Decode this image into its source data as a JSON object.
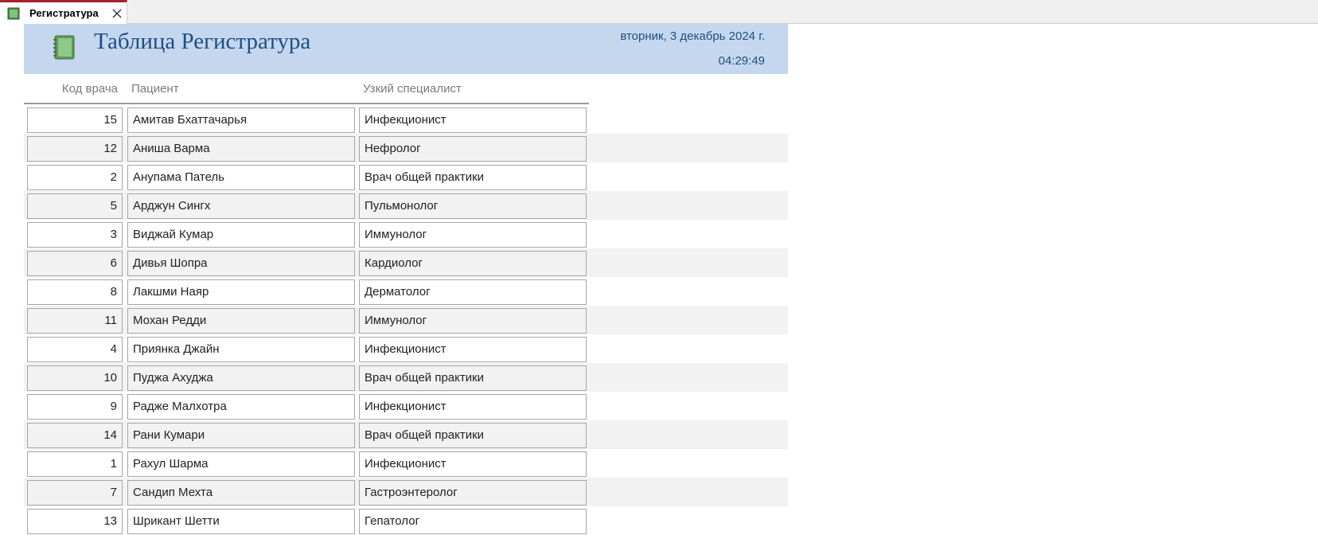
{
  "tab": {
    "label": "Регистратура",
    "icon": "report-icon",
    "close_icon": "close-icon"
  },
  "header": {
    "title": "Таблица Регистратура",
    "date": "вторник, 3 декабрь 2024 г.",
    "time": "04:29:49",
    "background": "#c5d7ef",
    "title_color": "#1f4e84"
  },
  "columns": {
    "code": "Код врача",
    "patient": "Пациент",
    "specialist": "Узкий специалист"
  },
  "rows": [
    {
      "code": "15",
      "patient": "Амитав Бхаттачарья",
      "specialist": "Инфекционист"
    },
    {
      "code": "12",
      "patient": "Аниша Варма",
      "specialist": "Нефролог"
    },
    {
      "code": "2",
      "patient": "Анупама Патель",
      "specialist": "Врач общей практики"
    },
    {
      "code": "5",
      "patient": "Арджун Сингх",
      "specialist": "Пульмонолог"
    },
    {
      "code": "3",
      "patient": "Виджай Кумар",
      "specialist": "Иммунолог"
    },
    {
      "code": "6",
      "patient": "Дивья Шопра",
      "specialist": "Кардиолог"
    },
    {
      "code": "8",
      "patient": "Лакшми Наяр",
      "specialist": "Дерматолог"
    },
    {
      "code": "11",
      "patient": "Мохан Редди",
      "specialist": "Иммунолог"
    },
    {
      "code": "4",
      "patient": "Приянка Джайн",
      "specialist": "Инфекционист"
    },
    {
      "code": "10",
      "patient": "Пуджа Ахуджа",
      "specialist": "Врач общей практики"
    },
    {
      "code": "9",
      "patient": "Радже Малхотра",
      "specialist": "Инфекционист"
    },
    {
      "code": "14",
      "patient": "Рани Кумари",
      "specialist": "Врач общей практики"
    },
    {
      "code": "1",
      "patient": "Рахул Шарма",
      "specialist": "Инфекционист"
    },
    {
      "code": "7",
      "patient": "Сандип Мехта",
      "specialist": "Гастроэнтеролог"
    },
    {
      "code": "13",
      "patient": "Шрикант Шетти",
      "specialist": "Гепатолог"
    }
  ]
}
